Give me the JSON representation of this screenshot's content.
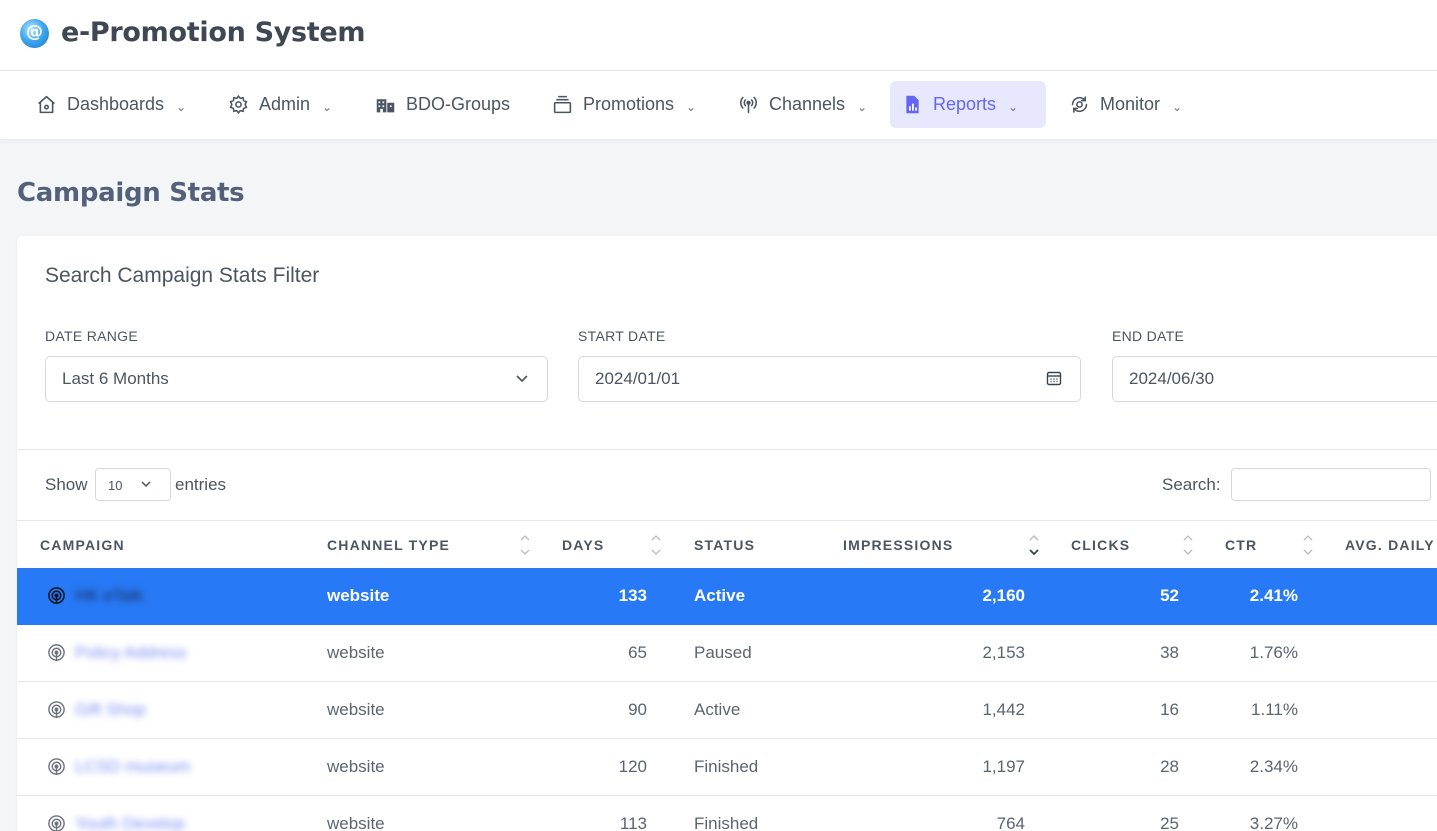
{
  "app": {
    "title": "e-Promotion System",
    "logo_icon": "app-logo-icon"
  },
  "nav": {
    "items": [
      {
        "label": "Dashboards",
        "icon": "home-icon",
        "has_dropdown": true,
        "active": false
      },
      {
        "label": "Admin",
        "icon": "gear-icon",
        "has_dropdown": true,
        "active": false
      },
      {
        "label": "BDO-Groups",
        "icon": "building-icon",
        "has_dropdown": false,
        "active": false
      },
      {
        "label": "Promotions",
        "icon": "stack-icon",
        "has_dropdown": true,
        "active": false
      },
      {
        "label": "Channels",
        "icon": "broadcast-icon",
        "has_dropdown": true,
        "active": false
      },
      {
        "label": "Reports",
        "icon": "report-icon",
        "has_dropdown": true,
        "active": true
      },
      {
        "label": "Monitor",
        "icon": "monitor-icon",
        "has_dropdown": true,
        "active": false
      }
    ],
    "active_color": "#6366f1"
  },
  "page": {
    "title": "Campaign Stats"
  },
  "filter": {
    "title": "Search Campaign Stats Filter",
    "date_range": {
      "label": "DATE RANGE",
      "value": "Last 6 Months"
    },
    "start_date": {
      "label": "START DATE",
      "value": "2024/01/01"
    },
    "end_date": {
      "label": "END DATE",
      "value": "2024/06/30"
    }
  },
  "table_controls": {
    "show_label": "Show",
    "page_length": "10",
    "entries_label": "entries",
    "search_label": "Search:",
    "search_value": ""
  },
  "table": {
    "columns": [
      "CAMPAIGN",
      "CHANNEL TYPE",
      "DAYS",
      "STATUS",
      "IMPRESSIONS",
      "CLICKS",
      "CTR",
      "AVG. DAILY I"
    ],
    "sorted_column": "IMPRESSIONS",
    "sort_direction": "descending",
    "selected_row_color": "#2779f6",
    "rows": [
      {
        "campaign": "HK eTalk",
        "channel_type": "website",
        "days": "133",
        "status": "Active",
        "impressions": "2,160",
        "clicks": "52",
        "ctr": "2.41%",
        "selected": true
      },
      {
        "campaign": "Policy Address",
        "channel_type": "website",
        "days": "65",
        "status": "Paused",
        "impressions": "2,153",
        "clicks": "38",
        "ctr": "1.76%",
        "selected": false
      },
      {
        "campaign": "Gift Shop",
        "channel_type": "website",
        "days": "90",
        "status": "Active",
        "impressions": "1,442",
        "clicks": "16",
        "ctr": "1.11%",
        "selected": false
      },
      {
        "campaign": "LCSD museum",
        "channel_type": "website",
        "days": "120",
        "status": "Finished",
        "impressions": "1,197",
        "clicks": "28",
        "ctr": "2.34%",
        "selected": false
      },
      {
        "campaign": "Youth Develop",
        "channel_type": "website",
        "days": "113",
        "status": "Finished",
        "impressions": "764",
        "clicks": "25",
        "ctr": "3.27%",
        "selected": false
      }
    ]
  }
}
